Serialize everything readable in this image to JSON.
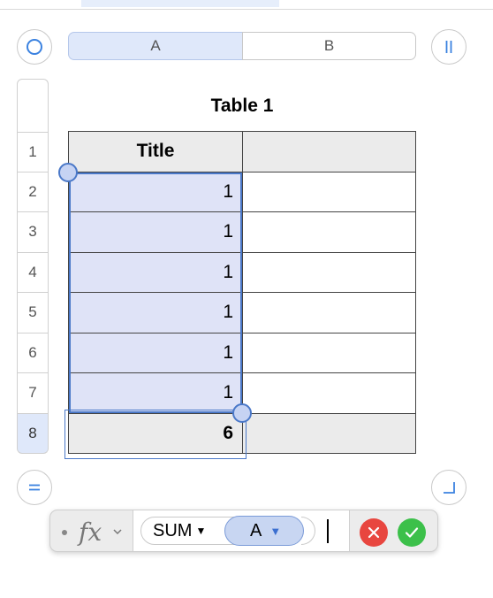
{
  "columns": {
    "a": "A",
    "b": "B"
  },
  "rows": [
    "1",
    "2",
    "3",
    "4",
    "5",
    "6",
    "7",
    "8"
  ],
  "table": {
    "title": "Table 1",
    "header": {
      "c1": "Title",
      "c2": ""
    },
    "body": [
      {
        "c1": "1",
        "c2": ""
      },
      {
        "c1": "1",
        "c2": ""
      },
      {
        "c1": "1",
        "c2": ""
      },
      {
        "c1": "1",
        "c2": ""
      },
      {
        "c1": "1",
        "c2": ""
      },
      {
        "c1": "1",
        "c2": ""
      }
    ],
    "footer": {
      "c1": "6",
      "c2": ""
    }
  },
  "formula_bar": {
    "fx": "fx",
    "function_name": "SUM",
    "argument": "A"
  },
  "colors": {
    "selection": "#4a78c8",
    "selection_fill": "#dfe3f7",
    "cancel": "#e8463f",
    "accept": "#3cc04a"
  },
  "icons": {
    "top_left": "select-all-circle-icon",
    "top_right": "freeze-columns-icon",
    "bottom_left": "freeze-rows-icon",
    "bottom_right": "resize-table-icon",
    "cancel": "x-icon",
    "accept": "checkmark-icon"
  }
}
